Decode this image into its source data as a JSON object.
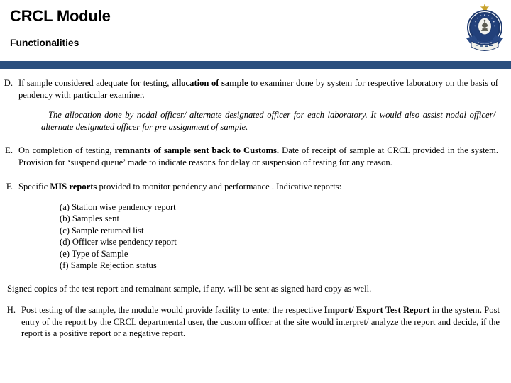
{
  "header": {
    "title": "CRCL Module",
    "subtitle": "Functionalities",
    "emblem_name": "indian-customs-central-excise-emblem",
    "bar_color": "#2b4f7e"
  },
  "items": {
    "d": {
      "marker": "D.",
      "text_1": "If sample considered adequate for testing, ",
      "bold_1": "allocation of sample",
      "text_2": " to examiner done by system for respective laboratory on the basis of pendency with particular examiner.",
      "note": "The allocation done by nodal officer/ alternate designated officer for each laboratory. It would also assist nodal officer/ alternate designated officer for pre assignment of sample."
    },
    "e": {
      "marker": "E.",
      "text_1": "On completion of testing, ",
      "bold_1": "remnants of sample sent back to Customs.",
      "text_2": " Date of receipt of sample at CRCL provided in the system. Provision for ‘suspend queue’ made to indicate reasons for delay or suspension of testing for any reason."
    },
    "f": {
      "marker": "F.",
      "text_1": "Specific ",
      "bold_1": "MIS reports",
      "text_2": " provided to monitor pendency and performance . Indicative reports:"
    },
    "h": {
      "marker": "H.",
      "text_1": "Post testing of the sample, the module would provide facility to enter the respective ",
      "bold_1": "Import/ Export Test Report",
      "text_2": " in the system. Post entry of the report by the CRCL departmental user, the custom officer at the site would interpret/ analyze the report and decide, if the report is a positive report or a negative report."
    }
  },
  "report_list": [
    "(a) Station wise pendency report",
    "(b) Samples sent",
    "(c) Sample returned list",
    "(d) Officer wise pendency report",
    "(e) Type of Sample",
    "(f) Sample Rejection status"
  ],
  "signed_note": "Signed copies of the test report and remainant sample, if any, will be sent as signed hard copy as well."
}
